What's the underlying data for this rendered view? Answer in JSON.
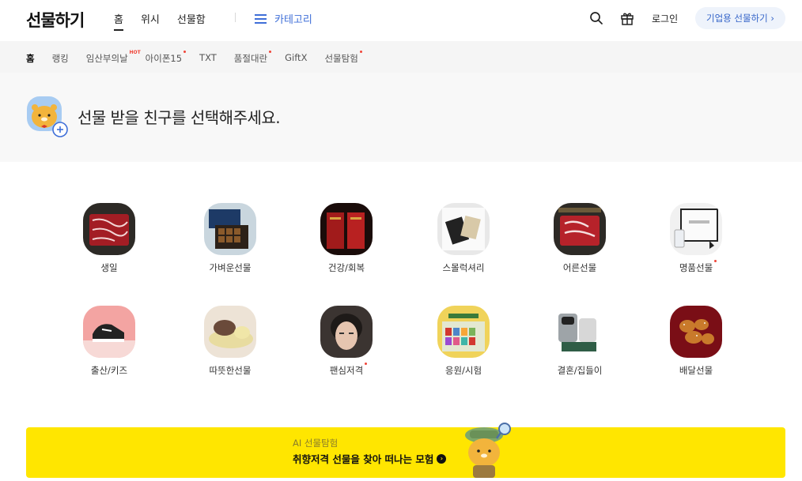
{
  "header": {
    "logo": "선물하기",
    "nav": [
      "홈",
      "위시",
      "선물함"
    ],
    "category_label": "카테고리",
    "login": "로그인",
    "biz_button": "기업용 선물하기 ›"
  },
  "subtabs": [
    {
      "label": "홈",
      "active": true
    },
    {
      "label": "랭킹"
    },
    {
      "label": "임산부의날",
      "badge": "HOT"
    },
    {
      "label": "아이폰15",
      "dot": true
    },
    {
      "label": "TXT"
    },
    {
      "label": "품절대란",
      "dot": true
    },
    {
      "label": "GiftX"
    },
    {
      "label": "선물탐험",
      "dot": true
    }
  ],
  "friend_prompt": "선물 받을 친구를 선택해주세요.",
  "categories": [
    {
      "label": "생일",
      "icon": "meat-gift-box"
    },
    {
      "label": "가벼운선물",
      "icon": "chocolate-box"
    },
    {
      "label": "건강/회복",
      "icon": "red-ginseng"
    },
    {
      "label": "스몰럭셔리",
      "icon": "luxury-items"
    },
    {
      "label": "어른선물",
      "icon": "premium-meat"
    },
    {
      "label": "명품선물",
      "icon": "perfume-box",
      "dot": true
    },
    {
      "label": "출산/키즈",
      "icon": "kids-shoes"
    },
    {
      "label": "따뜻한선물",
      "icon": "pillow"
    },
    {
      "label": "팬심저격",
      "icon": "idol-photo",
      "dot": true
    },
    {
      "label": "응원/시험",
      "icon": "snack-box"
    },
    {
      "label": "결혼/집들이",
      "icon": "coffee-machine"
    },
    {
      "label": "배달선물",
      "icon": "fried-chicken"
    }
  ],
  "banner": {
    "sub": "AI 선물탐험",
    "title": "취향저격 선물을 찾아 떠나는 모험"
  },
  "colors": {
    "accent": "#3f6fd8",
    "banner": "#ffe600",
    "dot": "#f04438"
  }
}
